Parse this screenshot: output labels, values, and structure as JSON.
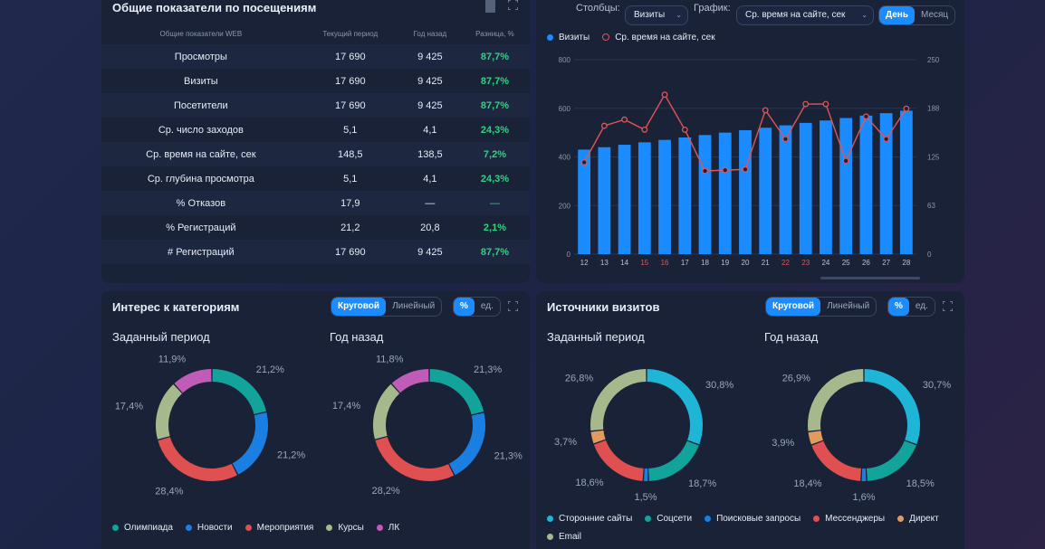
{
  "table_panel": {
    "title": "Общие показатели по посещениям",
    "headers": [
      "Общие показатели WEB",
      "Текущий период",
      "Год назад",
      "Разница, %"
    ],
    "rows": [
      [
        "Просмотры",
        "17 690",
        "9 425",
        "87,7%"
      ],
      [
        "Визиты",
        "17 690",
        "9 425",
        "87,7%"
      ],
      [
        "Посетители",
        "17 690",
        "9 425",
        "87,7%"
      ],
      [
        "Ср. число заходов",
        "5,1",
        "4,1",
        "24,3%"
      ],
      [
        "Ср. время на сайте, сек",
        "148,5",
        "138,5",
        "7,2%"
      ],
      [
        "Ср. глубина просмотра",
        "5,1",
        "4,1",
        "24,3%"
      ],
      [
        "% Отказов",
        "17,9",
        "—",
        "—"
      ],
      [
        "% Регистраций",
        "21,2",
        "20,8",
        "2,1%"
      ],
      [
        "# Регистраций",
        "17 690",
        "9 425",
        "87,7%"
      ]
    ]
  },
  "chart_panel": {
    "columns_label": "Столбцы:",
    "columns_value": "Визиты",
    "graph_label": "График:",
    "graph_value": "Ср. время на сайте, сек",
    "period_day": "День",
    "period_month": "Месяц",
    "legend_bar": "Визиты",
    "legend_line": "Ср. время на сайте, сек"
  },
  "chart_data": {
    "type": "bar",
    "categories": [
      "12",
      "13",
      "14",
      "15",
      "16",
      "17",
      "18",
      "19",
      "20",
      "21",
      "22",
      "23",
      "24",
      "25",
      "26",
      "27",
      "28"
    ],
    "weekend_categories": [
      "15",
      "16",
      "22",
      "23"
    ],
    "series": [
      {
        "name": "Визиты",
        "type": "bar",
        "axis": "left",
        "values": [
          430,
          440,
          450,
          460,
          470,
          480,
          490,
          500,
          510,
          520,
          530,
          540,
          550,
          560,
          570,
          580,
          590
        ]
      },
      {
        "name": "Ср. время на сайте, сек",
        "type": "line",
        "axis": "right",
        "values": [
          118,
          165,
          173,
          160,
          205,
          160,
          107,
          108,
          109,
          185,
          148,
          193,
          193,
          120,
          177,
          148,
          187
        ]
      }
    ],
    "ylim": [
      0,
      800
    ],
    "y2lim": [
      0,
      250
    ],
    "yticks": [
      0,
      200,
      400,
      600,
      800
    ],
    "y2ticks": [
      0,
      63,
      125,
      188,
      250
    ],
    "bar_color": "#1a8cff",
    "line_color": "#e05555"
  },
  "categories_panel": {
    "title": "Интерес к категориям",
    "toggle_pie": "Круговой",
    "toggle_line": "Линейный",
    "unit_pct": "%",
    "unit_abs": "ед.",
    "period_current": "Заданный период",
    "period_prev": "Год назад",
    "donuts": [
      {
        "values": [
          21.2,
          21.2,
          28.4,
          17.4,
          11.9
        ],
        "labels": [
          "21,2%",
          "21,2%",
          "28,4%",
          "17,4%",
          "11,9%"
        ]
      },
      {
        "values": [
          21.3,
          21.3,
          28.2,
          17.4,
          11.8
        ],
        "labels": [
          "21,3%",
          "21,3%",
          "28,2%",
          "17,4%",
          "11,8%"
        ]
      }
    ],
    "legend": [
      "Олимпиада",
      "Новости",
      "Мероприятия",
      "Курсы",
      "ЛК"
    ],
    "colors": [
      "#12a39a",
      "#1a7fe0",
      "#e05050",
      "#a7b88c",
      "#c05cb8"
    ]
  },
  "sources_panel": {
    "title": "Источники визитов",
    "toggle_pie": "Круговой",
    "toggle_line": "Линейный",
    "unit_pct": "%",
    "unit_abs": "ед.",
    "period_current": "Заданный период",
    "period_prev": "Год назад",
    "donuts": [
      {
        "values": [
          30.8,
          18.7,
          1.5,
          18.6,
          3.7,
          26.8
        ],
        "labels": [
          "30,8%",
          "18,7%",
          "1,5%",
          "18,6%",
          "3,7%",
          "26,8%"
        ]
      },
      {
        "values": [
          30.7,
          18.5,
          1.6,
          18.4,
          3.9,
          26.9
        ],
        "labels": [
          "30,7%",
          "18,5%",
          "1,6%",
          "18,4%",
          "3,9%",
          "26,9%"
        ]
      }
    ],
    "legend": [
      "Сторонние сайты",
      "Соцсети",
      "Поисковые запросы",
      "Мессенджеры",
      "Директ",
      "Email"
    ],
    "colors": [
      "#1fb5d6",
      "#12a39a",
      "#1a7fe0",
      "#e05050",
      "#e39a5e",
      "#a7b88c"
    ]
  }
}
